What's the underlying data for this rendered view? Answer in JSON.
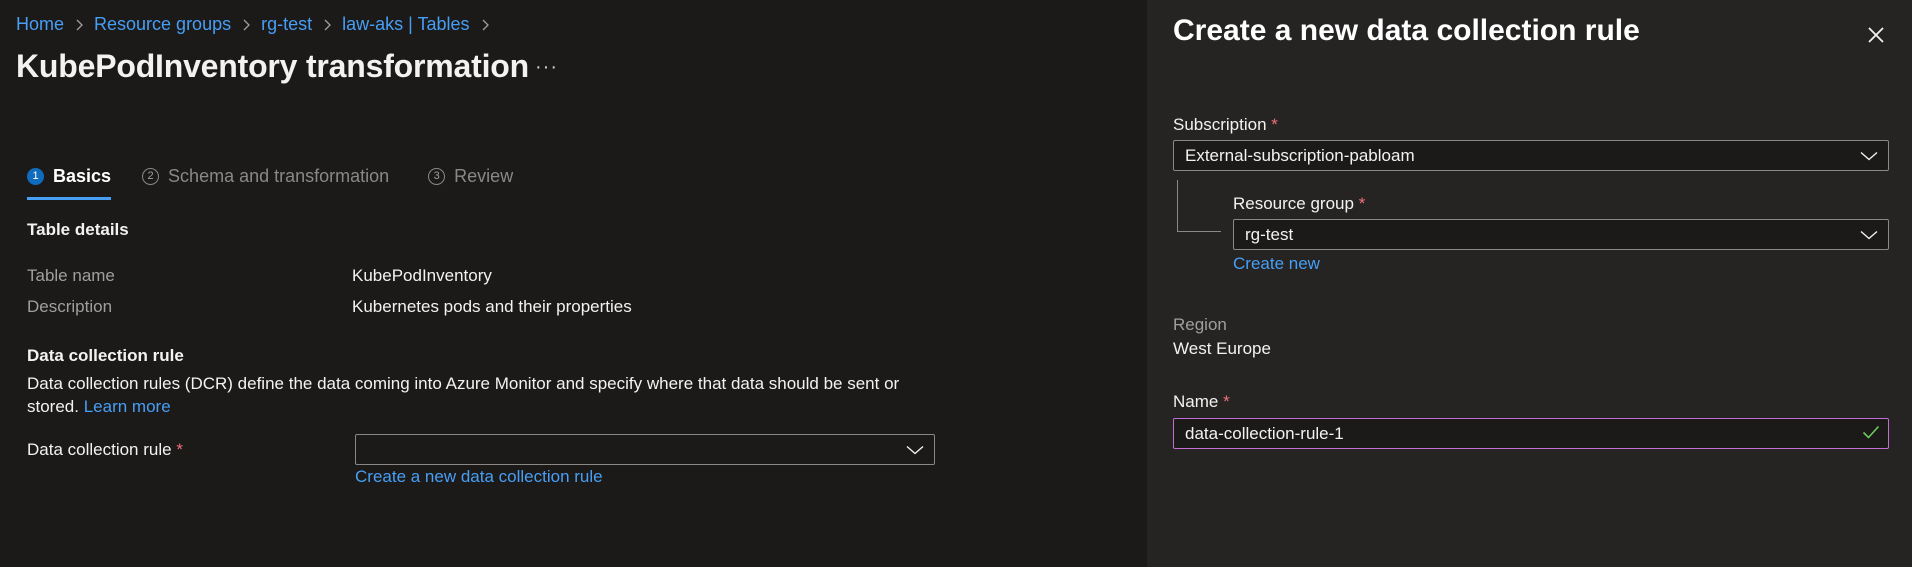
{
  "breadcrumb": {
    "items": [
      {
        "label": "Home"
      },
      {
        "label": "Resource groups"
      },
      {
        "label": "rg-test"
      },
      {
        "label": "law-aks | Tables"
      }
    ]
  },
  "page": {
    "title": "KubePodInventory transformation",
    "more_label": "···"
  },
  "steps": [
    {
      "number": "1",
      "label": "Basics",
      "active": true
    },
    {
      "number": "2",
      "label": "Schema and transformation",
      "active": false
    },
    {
      "number": "3",
      "label": "Review",
      "active": false
    }
  ],
  "table_details": {
    "heading": "Table details",
    "rows": [
      {
        "label": "Table name",
        "value": "KubePodInventory"
      },
      {
        "label": "Description",
        "value": "Kubernetes pods and their properties"
      }
    ]
  },
  "dcr_section": {
    "heading": "Data collection rule",
    "description": "Data collection rules (DCR) define the data coming into Azure Monitor and specify where that data should be sent or stored.",
    "learn_more": "Learn more",
    "field_label": "Data collection rule",
    "required_mark": "*",
    "selected_value": "",
    "create_link": "Create a new data collection rule"
  },
  "panel": {
    "title": "Create a new data collection rule",
    "subscription": {
      "label": "Subscription",
      "required_mark": "*",
      "value": "External-subscription-pabloam"
    },
    "resource_group": {
      "label": "Resource group",
      "required_mark": "*",
      "value": "rg-test",
      "create_link": "Create new"
    },
    "region": {
      "label": "Region",
      "value": "West Europe"
    },
    "name": {
      "label": "Name",
      "required_mark": "*",
      "value": "data-collection-rule-1"
    }
  },
  "colors": {
    "accent": "#479ef5",
    "required": "#f1707b",
    "valid_check": "#6ccb5f",
    "focus_border": "#c26dd6"
  }
}
